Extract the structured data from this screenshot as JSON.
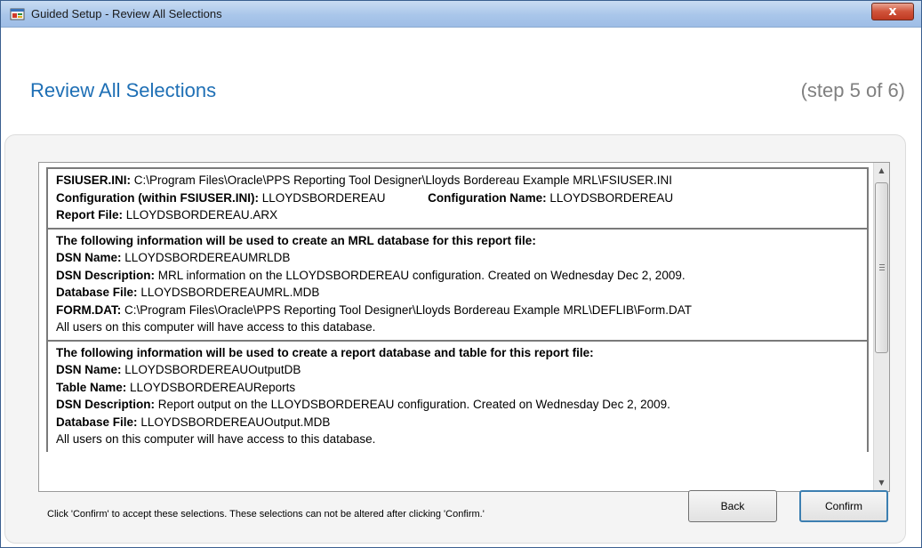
{
  "window": {
    "title": "Guided Setup - Review All Selections",
    "close_glyph": "x"
  },
  "header": {
    "title": "Review All Selections",
    "step": "(step 5 of 6)"
  },
  "sections": {
    "config": {
      "fsiuser_label": "FSIUSER.INI:",
      "fsiuser_value": "C:\\Program Files\\Oracle\\PPS Reporting Tool Designer\\Lloyds Bordereau Example MRL\\FSIUSER.INI",
      "configuration_label": "Configuration (within FSIUSER.INI):",
      "configuration_value": "LLOYDSBORDEREAU",
      "configuration_name_label": "Configuration Name:",
      "configuration_name_value": "LLOYDSBORDEREAU",
      "report_file_label": "Report File:",
      "report_file_value": "LLOYDSBORDEREAU.ARX"
    },
    "mrl": {
      "heading": "The following information will be used to create an MRL database for this report file:",
      "dsn_name_label": "DSN Name:",
      "dsn_name_value": "LLOYDSBORDEREAUMRLDB",
      "dsn_desc_label": "DSN Description:",
      "dsn_desc_value": "MRL information on the LLOYDSBORDEREAU configuration.  Created on Wednesday Dec 2, 2009.",
      "db_file_label": "Database File:",
      "db_file_value": "LLOYDSBORDEREAUMRL.MDB",
      "form_dat_label": "FORM.DAT:",
      "form_dat_value": "C:\\Program Files\\Oracle\\PPS Reporting Tool Designer\\Lloyds Bordereau Example MRL\\DEFLIB\\Form.DAT",
      "access_note": "All users on this computer will have access to this database."
    },
    "report": {
      "heading": "The following information will be used to create a report database and table for this report file:",
      "dsn_name_label": "DSN Name:",
      "dsn_name_value": "LLOYDSBORDEREAUOutputDB",
      "table_name_label": "Table Name:",
      "table_name_value": "LLOYDSBORDEREAUReports",
      "dsn_desc_label": "DSN Description:",
      "dsn_desc_value": "Report output on the LLOYDSBORDEREAU configuration.  Created on Wednesday Dec 2, 2009.",
      "db_file_label": "Database File:",
      "db_file_value": "LLOYDSBORDEREAUOutput.MDB",
      "access_note": "All users on this computer will have access to this database."
    }
  },
  "footer": {
    "hint": "Click 'Confirm' to accept these selections.  These selections can not be altered after clicking 'Confirm.'",
    "back_label": "Back",
    "confirm_label": "Confirm"
  },
  "scrollbar": {
    "up_glyph": "▲",
    "down_glyph": "▼"
  }
}
